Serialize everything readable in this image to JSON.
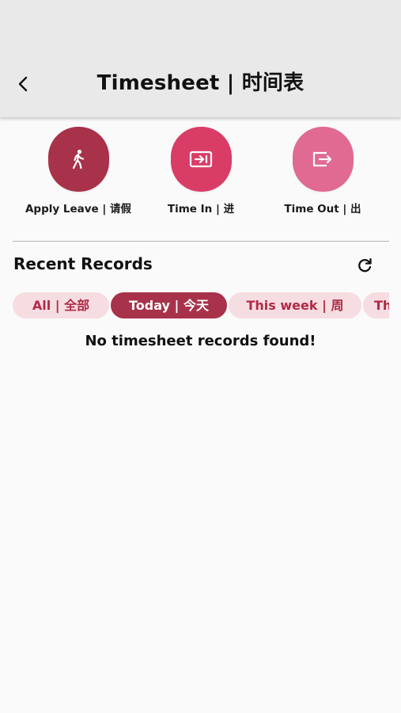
{
  "header": {
    "title": "Timesheet | 时间表",
    "back_icon": "back-arrow-icon"
  },
  "actions": [
    {
      "label": "Apply Leave | 请假",
      "icon": "walking-person-icon",
      "color": "#a8324a"
    },
    {
      "label": "Time In | 进",
      "icon": "login-icon",
      "color": "#d93d66"
    },
    {
      "label": "Time Out | 出",
      "icon": "logout-icon",
      "color": "#e06a92"
    }
  ],
  "records": {
    "title": "Recent Records",
    "refresh_icon": "refresh-icon",
    "filters": [
      {
        "label": "All | 全部",
        "active": false
      },
      {
        "label": "Today | 今天",
        "active": true
      },
      {
        "label": "This week | 周",
        "active": false
      },
      {
        "label": "Th",
        "active": false
      }
    ],
    "empty_message": "No timesheet records found!"
  },
  "colors": {
    "accent": "#a8324a",
    "chip_bg": "#f6dde2",
    "chip_text": "#b02a45",
    "appbar_bg": "#e9e9e9"
  }
}
